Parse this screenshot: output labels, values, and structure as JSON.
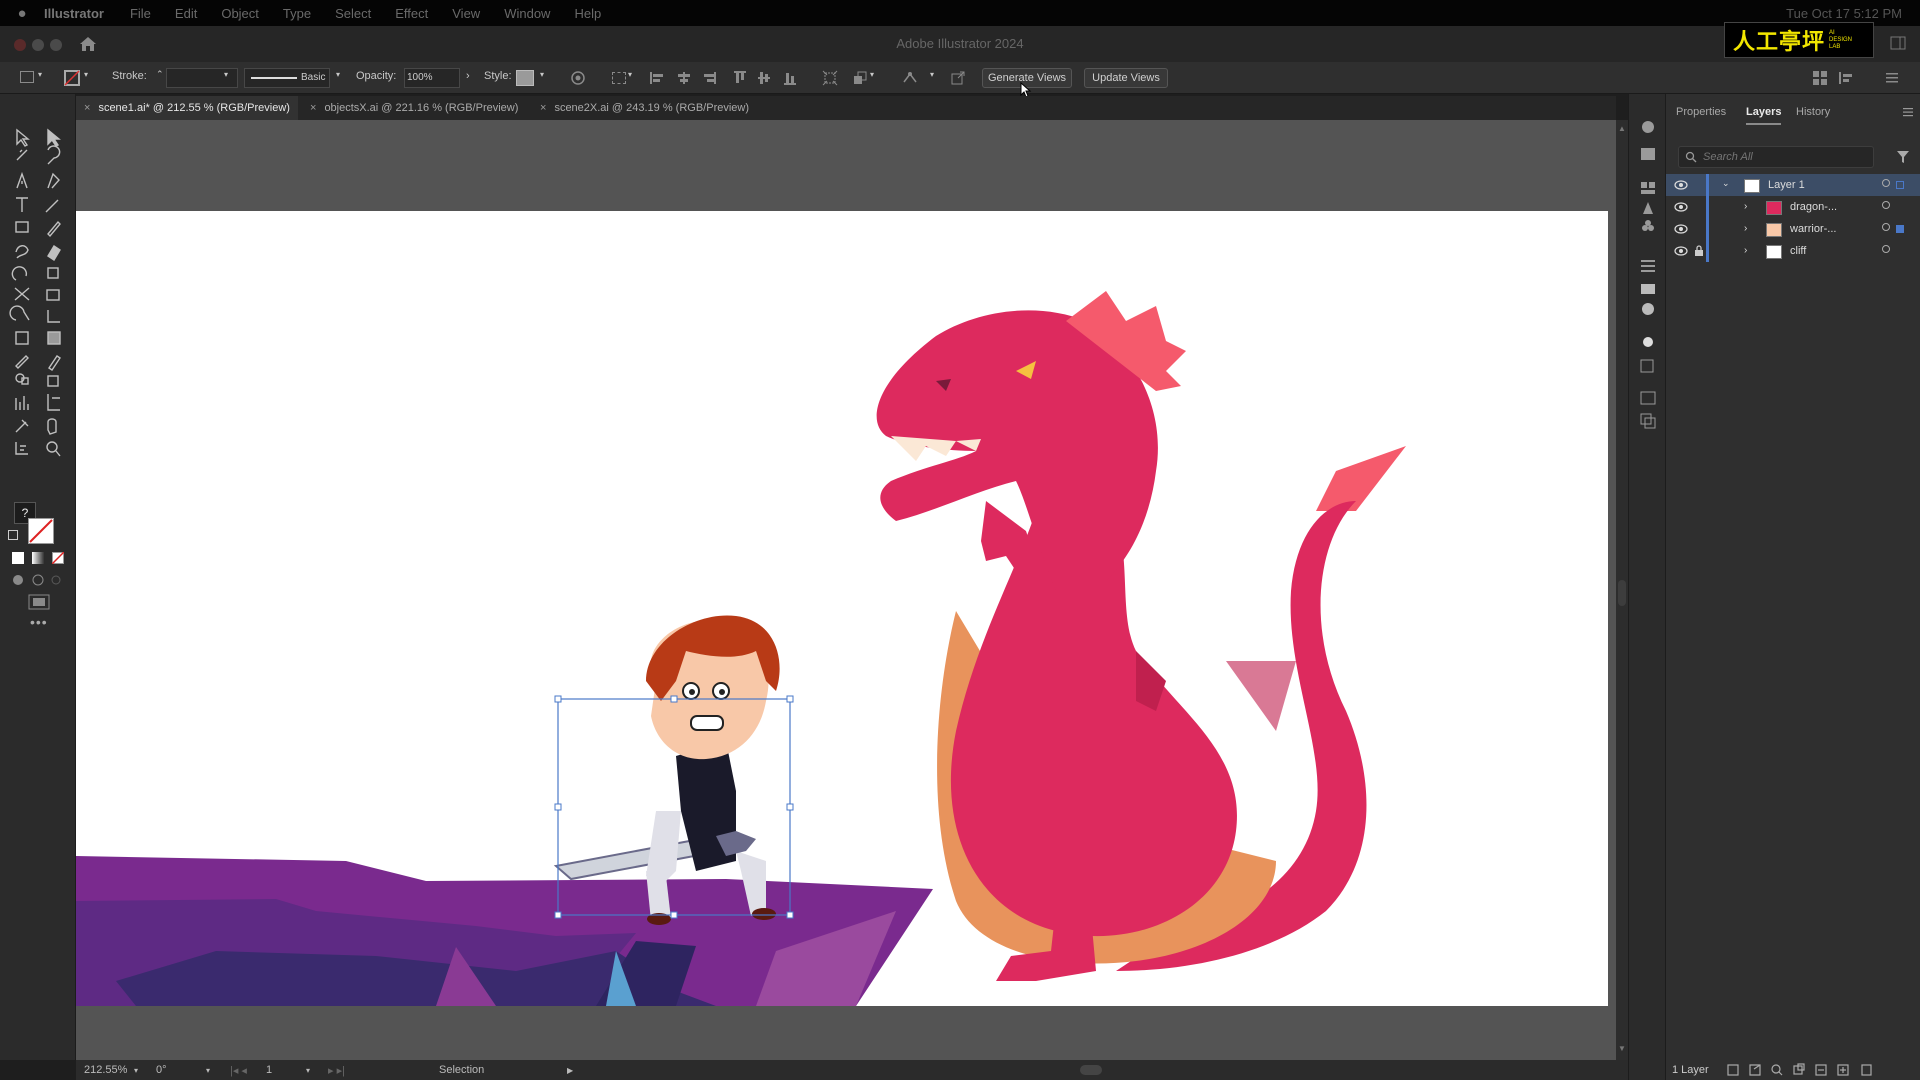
{
  "menubar": {
    "app": "Illustrator",
    "items": [
      "File",
      "Edit",
      "Object",
      "Type",
      "Select",
      "Effect",
      "View",
      "Window",
      "Help"
    ],
    "clock": "Tue Oct 17  5:12 PM"
  },
  "window": {
    "title": "Adobe Illustrator 2024"
  },
  "logo": {
    "text": "人工亭坪",
    "sub_lines": [
      "AI",
      "DESIGN",
      "LAB"
    ]
  },
  "controlbar": {
    "stroke_label": "Stroke:",
    "brush_label": "Basic",
    "opacity_label": "Opacity:",
    "opacity_value": "100%",
    "style_label": "Style:",
    "generate_views": "Generate Views",
    "update_views": "Update Views"
  },
  "tabs": [
    {
      "label": "scene1.ai* @ 212.55 % (RGB/Preview)",
      "active": true
    },
    {
      "label": "objectsX.ai @ 221.16 % (RGB/Preview)",
      "active": false
    },
    {
      "label": "scene2X.ai @ 243.19 % (RGB/Preview)",
      "active": false
    }
  ],
  "statusbar": {
    "zoom": "212.55%",
    "rotation": "0°",
    "artboard": "1",
    "tool": "Selection"
  },
  "panel": {
    "tabs": [
      "Properties",
      "Layers",
      "History"
    ],
    "active_tab": "Layers",
    "search_placeholder": "Search All",
    "layers": [
      {
        "name": "Layer 1",
        "level": 0,
        "expanded": true,
        "selected": true,
        "locked": false
      },
      {
        "name": "dragon-...",
        "level": 1,
        "expanded": false,
        "selected": false,
        "locked": false
      },
      {
        "name": "warrior-...",
        "level": 1,
        "expanded": false,
        "selected": false,
        "locked": false
      },
      {
        "name": "cliff",
        "level": 1,
        "expanded": false,
        "selected": false,
        "locked": true
      }
    ],
    "footer": "1 Layer"
  },
  "colors": {
    "dragon": "#dd2a5e",
    "dragon_belly": "#e8935c",
    "dragon_crest": "#f55a6c",
    "cliff_light": "#7a2a8e",
    "cliff_dark": "#3a2a6e",
    "selection": "#4a78c8",
    "layer_highlight": "#3c4d66"
  }
}
